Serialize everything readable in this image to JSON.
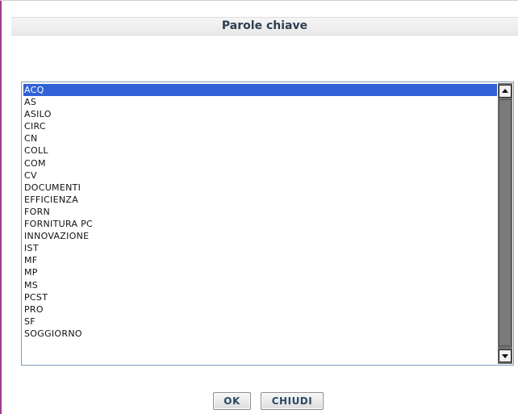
{
  "dialog": {
    "title": "Parole chiave"
  },
  "keywords": {
    "selected_index": 0,
    "items": [
      "ACQ",
      "AS",
      "ASILO",
      "CIRC",
      "CN",
      "COLL",
      "COM",
      "CV",
      "DOCUMENTI",
      "EFFICIENZA",
      "FORN",
      "FORNITURA PC",
      "INNOVAZIONE",
      "IST",
      "MF",
      "MP",
      "MS",
      "PCST",
      "PRO",
      "SF",
      "SOGGIORNO"
    ]
  },
  "buttons": {
    "ok_label": "OK",
    "close_label": "CHIUDI"
  },
  "colors": {
    "selection": "#3162d6",
    "accent_border": "#a23b8a",
    "title_text": "#2f3f52",
    "button_text": "#2b4a66"
  }
}
